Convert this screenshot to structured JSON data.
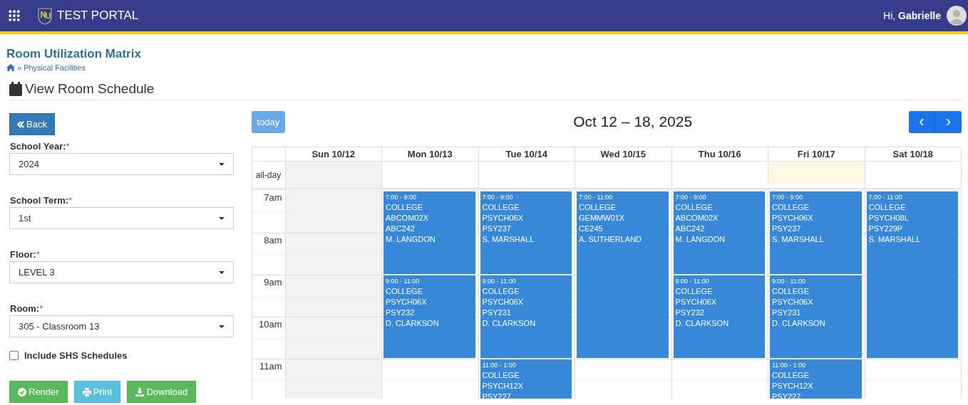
{
  "header": {
    "app_title": "TEST PORTAL",
    "greeting": "Hi, **Gabrielle**"
  },
  "page": {
    "title": "Room Utilization Matrix",
    "breadcrumb_separator": "»",
    "breadcrumb": "Physical Facilities",
    "section_title": "View Room Schedule"
  },
  "form": {
    "back": "Back",
    "fields": [
      {
        "label": "School Year:",
        "required": "*",
        "value": "2024"
      },
      {
        "label": "School Term:",
        "required": "*",
        "value": "1st"
      },
      {
        "label": "Floor:",
        "required": "*",
        "value": "LEVEL 3"
      },
      {
        "label": "Room:",
        "required": "*",
        "value": "305 - Classroom 13"
      }
    ],
    "include_shs": {
      "label": "Include SHS Schedules",
      "checked": false
    },
    "buttons": [
      {
        "kind": "render",
        "label": "Render"
      },
      {
        "kind": "print",
        "label": "Print"
      },
      {
        "kind": "download",
        "label": "Download"
      }
    ]
  },
  "calendar": {
    "today_button": {
      "label": "today",
      "disabled": true
    },
    "title": "Oct 12 – 18, 2025",
    "prev": "‹",
    "next": "›",
    "all_day_label": "all-day",
    "hours": [
      "7am",
      "8am",
      "9am",
      "10am",
      "11am"
    ],
    "days": [
      {
        "label": "Sun 10/12",
        "shaded": true,
        "today": false
      },
      {
        "label": "Mon 10/13",
        "shaded": false,
        "today": false,
        "events": [
          {
            "time": "7:00 - 9:00",
            "lines": [
              "COLLEGE",
              "ABCOM02X",
              "ABC242",
              "M. LANGDON"
            ]
          },
          {
            "time": "9:00 - 11:00",
            "lines": [
              "COLLEGE",
              "PSYCH06X",
              "PSY232",
              "D. CLARKSON"
            ]
          }
        ]
      },
      {
        "label": "Tue 10/14",
        "shaded": false,
        "today": false,
        "events": [
          {
            "time": "7:00 - 9:00",
            "lines": [
              "COLLEGE",
              "PSYCH06X",
              "PSY237",
              "S. MARSHALL"
            ]
          },
          {
            "time": "9:00 - 11:00",
            "lines": [
              "COLLEGE",
              "PSYCH06X",
              "PSY231",
              "D. CLARKSON"
            ]
          },
          {
            "time": "11:00 - 1:00",
            "lines": [
              "COLLEGE",
              "PSYCH12X",
              "PSY227"
            ]
          }
        ]
      },
      {
        "label": "Wed 10/15",
        "shaded": false,
        "today": false,
        "events": [
          {
            "time": "7:00 - 11:00",
            "lines": [
              "COLLEGE",
              "GEMMW01X",
              "CE245",
              "A. SUTHERLAND"
            ]
          }
        ]
      },
      {
        "label": "Thu 10/16",
        "shaded": false,
        "today": false,
        "events": [
          {
            "time": "7:00 - 9:00",
            "lines": [
              "COLLEGE",
              "ABCOM02X",
              "ABC242",
              "M. LANGDON"
            ]
          },
          {
            "time": "9:00 - 11:00",
            "lines": [
              "COLLEGE",
              "PSYCH06X",
              "PSY232",
              "D. CLARKSON"
            ]
          }
        ]
      },
      {
        "label": "Fri 10/17",
        "shaded": false,
        "today": true,
        "events": [
          {
            "time": "7:00 - 9:00",
            "lines": [
              "COLLEGE",
              "PSYCH06X",
              "PSY237",
              "S. MARSHALL"
            ]
          },
          {
            "time": "9:00 - 11:00",
            "lines": [
              "COLLEGE",
              "PSYCH06X",
              "PSY231",
              "D. CLARKSON"
            ]
          },
          {
            "time": "11:00 - 1:00",
            "lines": [
              "COLLEGE",
              "PSYCH12X",
              "PSY227"
            ]
          }
        ]
      },
      {
        "label": "Sat 10/18",
        "shaded": false,
        "today": false,
        "events": [
          {
            "time": "7:00 - 11:00",
            "lines": [
              "COLLEGE",
              "PSYCH08L",
              "PSY229P",
              "S. MARSHALL"
            ]
          }
        ]
      }
    ]
  }
}
